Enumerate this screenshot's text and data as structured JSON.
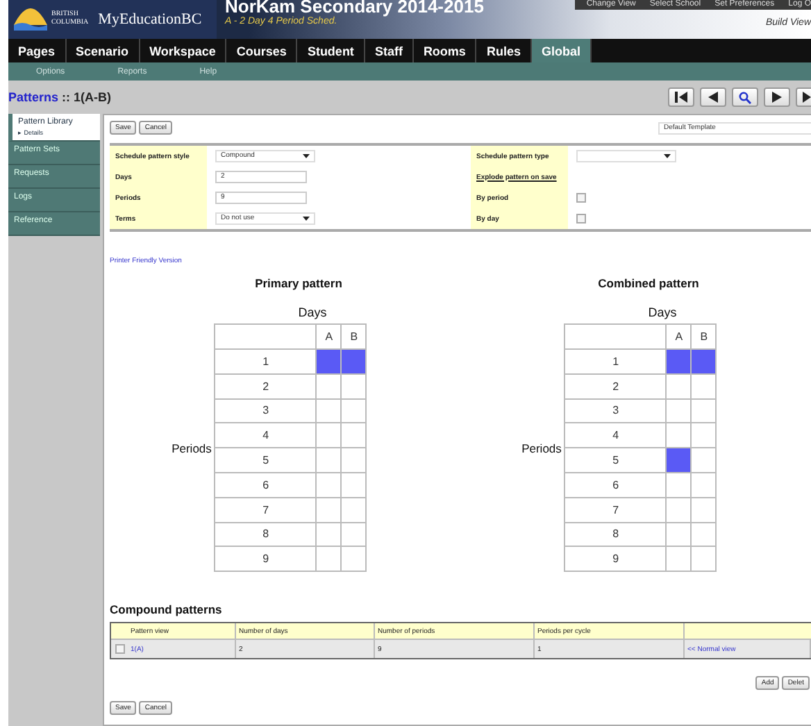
{
  "header": {
    "logo_line1": "BRITISH",
    "logo_line2": "COLUMBIA",
    "product": "MyEducationBC",
    "school": "NorKam Secondary 2014-2015",
    "schedule": "A - 2 Day 4 Period Sched.",
    "links": [
      "Change View",
      "Select School",
      "Set Preferences",
      "Log O"
    ],
    "view": "Build View"
  },
  "nav": [
    {
      "label": "Pages",
      "selected": false
    },
    {
      "label": "Scenario",
      "selected": false
    },
    {
      "label": "Workspace",
      "selected": false
    },
    {
      "label": "Courses",
      "selected": false
    },
    {
      "label": "Student",
      "selected": false
    },
    {
      "label": "Staff",
      "selected": false
    },
    {
      "label": "Rooms",
      "selected": false
    },
    {
      "label": "Rules",
      "selected": false
    },
    {
      "label": "Global",
      "selected": true
    }
  ],
  "subnav": [
    "Options",
    "Reports",
    "Help"
  ],
  "page_title": {
    "label": "Patterns",
    "sep": " :: ",
    "name": "1(A-B)"
  },
  "sidebar": [
    {
      "label": "Pattern Library",
      "selected": true,
      "sub": "▸ Details"
    },
    {
      "label": "Pattern Sets",
      "selected": false
    },
    {
      "label": "Requests",
      "selected": false
    },
    {
      "label": "Logs",
      "selected": false
    },
    {
      "label": "Reference",
      "selected": false
    }
  ],
  "toolbar": {
    "buttons": [
      "Save",
      "Cancel"
    ],
    "template": "Default Template"
  },
  "form_left": [
    {
      "kind": "select",
      "label": "Schedule pattern style",
      "value": "Compound"
    },
    {
      "kind": "text",
      "label": "Days",
      "value": "2"
    },
    {
      "kind": "text",
      "label": "Periods",
      "value": "9"
    },
    {
      "kind": "select",
      "label": "Terms",
      "value": "Do not use"
    }
  ],
  "form_right": [
    {
      "kind": "select",
      "label": "Schedule pattern type"
    },
    {
      "kind": "link",
      "label": "Explode pattern on save"
    },
    {
      "kind": "checkbox",
      "label": "By period",
      "checked": false
    },
    {
      "kind": "checkbox",
      "label": "By day",
      "checked": false
    }
  ],
  "printer_link": "Printer Friendly Version",
  "patterns": [
    {
      "title": "Primary pattern",
      "days_label": "Days",
      "periods_label": "Periods",
      "columns": [
        "A",
        "B"
      ],
      "rows": [
        {
          "label": "1",
          "cells": [
            {
              "selected": true
            },
            {
              "selected": true
            }
          ]
        },
        {
          "label": "2",
          "cells": [
            {
              "selected": false
            },
            {
              "selected": false
            }
          ]
        },
        {
          "label": "3",
          "cells": [
            {
              "selected": false
            },
            {
              "selected": false
            }
          ]
        },
        {
          "label": "4",
          "cells": [
            {
              "selected": false
            },
            {
              "selected": false
            }
          ]
        },
        {
          "label": "5",
          "cells": [
            {
              "selected": false
            },
            {
              "selected": false
            }
          ]
        },
        {
          "label": "6",
          "cells": [
            {
              "selected": false
            },
            {
              "selected": false
            }
          ]
        },
        {
          "label": "7",
          "cells": [
            {
              "selected": false
            },
            {
              "selected": false
            }
          ]
        },
        {
          "label": "8",
          "cells": [
            {
              "selected": false
            },
            {
              "selected": false
            }
          ]
        },
        {
          "label": "9",
          "cells": [
            {
              "selected": false
            },
            {
              "selected": false
            }
          ]
        }
      ]
    },
    {
      "title": "Combined pattern",
      "days_label": "Days",
      "periods_label": "Periods",
      "columns": [
        "A",
        "B"
      ],
      "rows": [
        {
          "label": "1",
          "cells": [
            {
              "selected": true
            },
            {
              "selected": true
            }
          ]
        },
        {
          "label": "2",
          "cells": [
            {
              "selected": false
            },
            {
              "selected": false
            }
          ]
        },
        {
          "label": "3",
          "cells": [
            {
              "selected": false
            },
            {
              "selected": false
            }
          ]
        },
        {
          "label": "4",
          "cells": [
            {
              "selected": false
            },
            {
              "selected": false
            }
          ]
        },
        {
          "label": "5",
          "cells": [
            {
              "selected": true
            },
            {
              "selected": false
            }
          ]
        },
        {
          "label": "6",
          "cells": [
            {
              "selected": false
            },
            {
              "selected": false
            }
          ]
        },
        {
          "label": "7",
          "cells": [
            {
              "selected": false
            },
            {
              "selected": false
            }
          ]
        },
        {
          "label": "8",
          "cells": [
            {
              "selected": false
            },
            {
              "selected": false
            }
          ]
        },
        {
          "label": "9",
          "cells": [
            {
              "selected": false
            },
            {
              "selected": false
            }
          ]
        }
      ]
    }
  ],
  "compound": {
    "title": "Compound patterns",
    "columns": [
      "Pattern view",
      "Number of days",
      "Number of periods",
      "Periods per cycle"
    ],
    "rows": [
      {
        "checked": false,
        "pattern": "1(A)",
        "days": "2",
        "periods": "9",
        "per_cycle": "1",
        "link": "<< Normal view"
      }
    ],
    "buttons": [
      "Add",
      "Delet"
    ]
  },
  "bottom_buttons": [
    "Save",
    "Cancel"
  ]
}
